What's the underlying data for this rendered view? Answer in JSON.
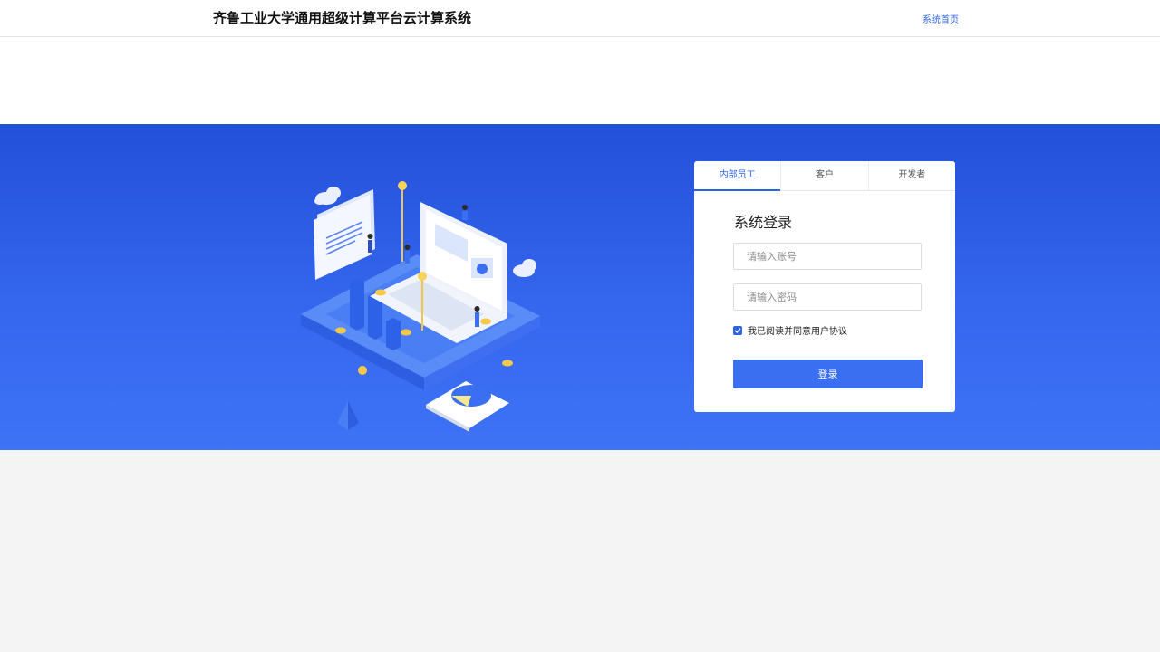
{
  "header": {
    "title": "齐鲁工业大学通用超级计算平台云计算系统",
    "home_link": "系统首页"
  },
  "login": {
    "tabs": [
      {
        "label": "内部员工",
        "active": true
      },
      {
        "label": "客户",
        "active": false
      },
      {
        "label": "开发者",
        "active": false
      }
    ],
    "title": "系统登录",
    "account_placeholder": "请输入账号",
    "password_placeholder": "请输入密码",
    "agree_checked": true,
    "agree_label": "我已阅读并同意用户协议",
    "submit_label": "登录"
  },
  "colors": {
    "accent": "#2b63e6",
    "hero_top": "#2350d8",
    "hero_bottom": "#3e73f6",
    "page_bg": "#f4f4f4"
  }
}
